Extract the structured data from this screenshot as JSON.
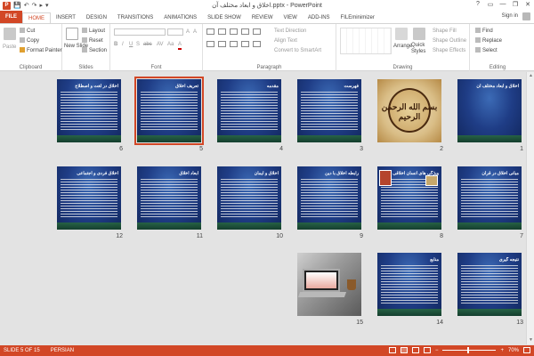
{
  "window": {
    "title": "اخلاق و ابعاد مختلف آن.pptx - PowerPoint",
    "controls": [
      "?",
      "▭",
      "—",
      "❐",
      "✕"
    ],
    "quick_access": [
      "💾",
      "↶",
      "↷",
      "▸",
      "▾"
    ]
  },
  "tabs": [
    "FILE",
    "HOME",
    "INSERT",
    "DESIGN",
    "TRANSITIONS",
    "ANIMATIONS",
    "SLIDE SHOW",
    "REVIEW",
    "VIEW",
    "ADD-INS",
    "FILEminimizer"
  ],
  "active_tab": "HOME",
  "signin": "Sign in",
  "ribbon": {
    "clipboard": {
      "label": "Clipboard",
      "paste": "Paste",
      "cut": "Cut",
      "copy": "Copy",
      "format_painter": "Format Painter"
    },
    "slides": {
      "label": "Slides",
      "new_slide": "New Slide",
      "layout": "Layout",
      "reset": "Reset",
      "section": "Section"
    },
    "font": {
      "label": "Font",
      "buttons": [
        "B",
        "I",
        "U",
        "S",
        "abc",
        "AV",
        "Aa",
        "A"
      ]
    },
    "paragraph": {
      "label": "Paragraph",
      "text_direction": "Text Direction",
      "align_text": "Align Text",
      "smartart": "Convert to SmartArt"
    },
    "drawing": {
      "label": "Drawing",
      "arrange": "Arrange",
      "quick_styles": "Quick Styles",
      "shape_fill": "Shape Fill",
      "shape_outline": "Shape Outline",
      "shape_effects": "Shape Effects"
    },
    "editing": {
      "label": "Editing",
      "find": "Find",
      "replace": "Replace",
      "select": "Select"
    }
  },
  "slides": [
    {
      "num": "1",
      "title": "اخلاق و ابعاد مختلف آن",
      "kind": "title"
    },
    {
      "num": "2",
      "title": "بسم الله الرحمن الرحیم",
      "kind": "calligraphy"
    },
    {
      "num": "3",
      "title": "فهرست",
      "kind": "text"
    },
    {
      "num": "4",
      "title": "مقدمه",
      "kind": "text"
    },
    {
      "num": "5",
      "title": "تعریف اخلاق",
      "kind": "text"
    },
    {
      "num": "6",
      "title": "اخلاق در لغت و اصطلاح",
      "kind": "text"
    },
    {
      "num": "7",
      "title": "مبانی اخلاق در قرآن",
      "kind": "text"
    },
    {
      "num": "8",
      "title": "ویژگی های انسان اخلاقی",
      "kind": "text"
    },
    {
      "num": "9",
      "title": "رابطه اخلاق با دین",
      "kind": "text"
    },
    {
      "num": "10",
      "title": "اخلاق و ایمان",
      "kind": "text"
    },
    {
      "num": "11",
      "title": "ابعاد اخلاق",
      "kind": "text"
    },
    {
      "num": "12",
      "title": "اخلاق فردی و اجتماعی",
      "kind": "text"
    },
    {
      "num": "13",
      "title": "نتیجه گیری",
      "kind": "text"
    },
    {
      "num": "14",
      "title": "منابع",
      "kind": "text"
    },
    {
      "num": "15",
      "title": "",
      "kind": "photo"
    }
  ],
  "selected_slide": "5",
  "status": {
    "slide": "SLIDE 5 OF 15",
    "language": "PERSIAN",
    "zoom": "70%"
  }
}
